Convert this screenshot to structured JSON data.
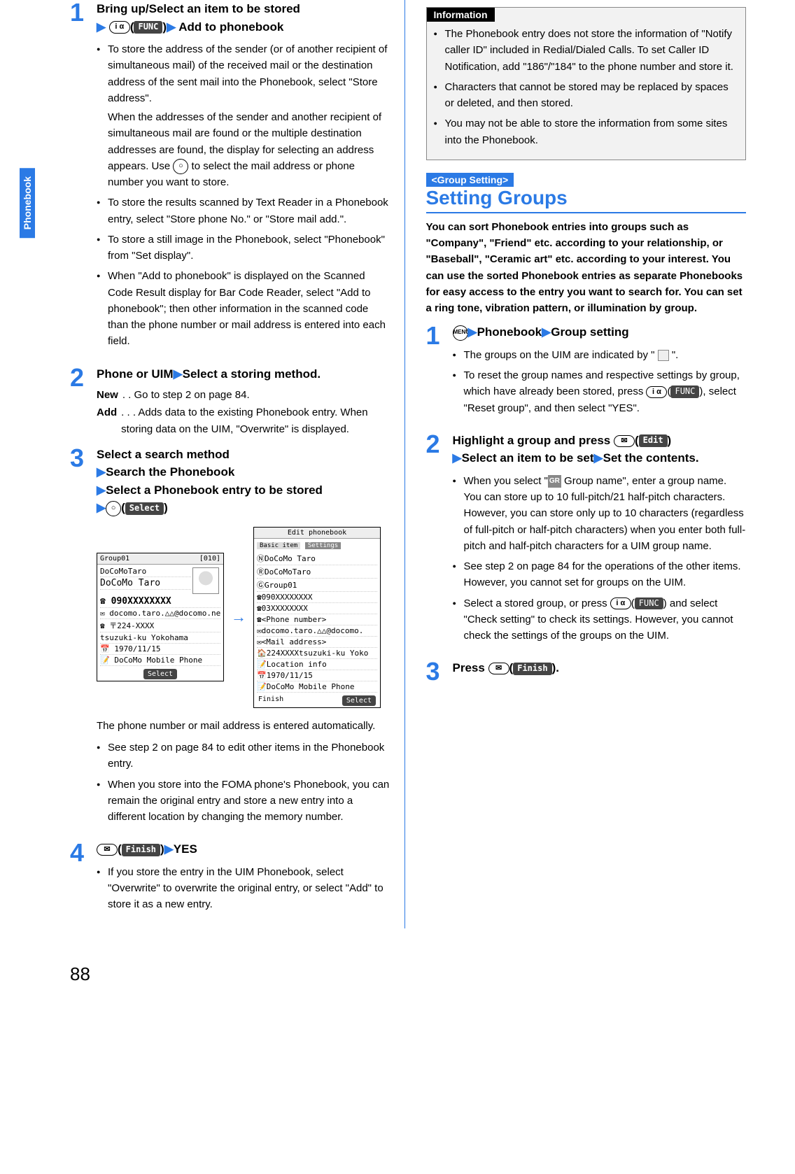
{
  "side_tab": "Phonebook",
  "page_number": "88",
  "left": {
    "step1": {
      "title_a": "Bring up/Select an item to be stored",
      "key1": "i α",
      "func": "FUNC",
      "title_b": "Add to phonebook",
      "b1": "To store the address of the sender (or of another recipient of simultaneous mail) of the received mail or the destination address of the sent mail into the Phonebook, select \"Store address\".",
      "b1_sub": "When the addresses of the sender and another recipient of simultaneous mail are found or the multiple destination addresses are found, the display for selecting an address appears. Use ",
      "b1_sub2": " to select the mail address or phone number you want to store.",
      "circle": "○",
      "b2": "To store the results scanned by Text Reader in a Phonebook entry, select \"Store phone No.\" or \"Store mail add.\".",
      "b3": "To store a still image in the Phonebook, select \"Phonebook\" from \"Set display\".",
      "b4": "When \"Add to phonebook\" is displayed on the Scanned Code Result display for Bar Code Reader, select \"Add to phonebook\"; then other information in the scanned code than the phone number or mail address is entered into each field."
    },
    "step2": {
      "title_a": "Phone or UIM",
      "title_b": "Select a storing method.",
      "new_label": "New",
      "new_text": ". . Go to step 2 on page 84.",
      "add_label": "Add",
      "add_text": ". . . Adds data to the existing Phonebook entry. When storing data on the UIM, \"Overwrite\" is displayed."
    },
    "step3": {
      "title_a": "Select a search method",
      "title_b": "Search the Phonebook",
      "title_c": "Select a Phonebook entry to be stored",
      "select_badge": "Select",
      "circle": "○",
      "fig_left": {
        "head_l": "Group01",
        "head_r": "[010]",
        "l1": "DoCoMoTaro",
        "l2": "DoCoMo Taro",
        "l3": "☎ 090XXXXXXXX",
        "l4": "✉ docomo.taro.△△@docomo.ne.jp",
        "l5": "☎ 〒224-XXXX",
        "l6": "  tsuzuki-ku Yokohama",
        "l7": "📅 1970/11/15",
        "l8": "📝 DoCoMo Mobile Phone",
        "footer": "Select"
      },
      "fig_right": {
        "head": "Edit phonebook",
        "tab1": "Basic item",
        "tab2": "Settings",
        "l1": "ⓃDoCoMo Taro",
        "l2": "ⓇDoCoMoTaro",
        "l3": "ⒼGroup01",
        "l4": "☎090XXXXXXXX",
        "l5": "☎03XXXXXXXX",
        "l6": "☎<Phone number>",
        "l7": "✉docomo.taro.△△@docomo.",
        "l8": "✉<Mail address>",
        "l9": "🏠224XXXXtsuzuki-ku Yoko",
        "l10": "📝Location info",
        "l11": "📅1970/11/15",
        "l12": "📝DoCoMo Mobile Phone",
        "footer_l": "Finish",
        "footer_r": "Select"
      },
      "after_fig_1": "The phone number or mail address is entered automatically.",
      "b1": "See step 2 on page 84 to edit other items in the Phonebook entry.",
      "b2": "When you store into the FOMA phone's Phonebook, you can remain the original entry and store a new entry into a different location by changing the memory number."
    },
    "step4": {
      "mail": "✉",
      "finish": "Finish",
      "yes": "YES",
      "b1": "If you store the entry in the UIM Phonebook, select \"Overwrite\" to overwrite the original entry, or select \"Add\" to store it as a new entry."
    }
  },
  "right": {
    "info_label": "Information",
    "info_b1": "The Phonebook entry does not store the information of \"Notify caller ID\" included in Redial/Dialed Calls. To set Caller ID Notification, add \"186\"/\"184\" to the phone number and store it.",
    "info_b2": "Characters that cannot be stored may be replaced by spaces or deleted, and then stored.",
    "info_b3": "You may not be able to store the information from some sites into the Phonebook.",
    "sect_tag": "<Group Setting>",
    "sect_title": "Setting Groups",
    "intro": "You can sort Phonebook entries into groups such as \"Company\", \"Friend\" etc. according to your relationship, or \"Baseball\", \"Ceramic art\" etc. according to your interest. You can use the sorted Phonebook entries as separate Phonebooks for easy access to the entry you want to search for. You can set a ring tone, vibration pattern, or illumination by group.",
    "step1": {
      "menu": "MENU",
      "title_a": "Phonebook",
      "title_b": "Group setting",
      "b1_a": "The groups on the UIM are indicated by \" ",
      "b1_b": " \".",
      "b2_a": "To reset the group names and respective settings by group, which have already been stored, press ",
      "key": "i α",
      "func": "FUNC",
      "b2_b": ", select \"Reset group\", and then select \"YES\"."
    },
    "step2": {
      "title_a": "Highlight a group and press ",
      "mail": "✉",
      "edit": "Edit",
      "title_b": "Select an item to be set",
      "title_c": "Set the contents.",
      "b1_a": "When you select \"",
      "gr": "GR",
      "b1_b": " Group name\", enter a group name. You can store up to 10 full-pitch/21 half-pitch characters. However, you can store only up to 10 characters (regardless of full-pitch or half-pitch characters) when you enter both full-pitch and half-pitch characters for a UIM group name.",
      "b2": "See step 2 on page 84 for the operations of the other items. However, you cannot set for groups on the UIM.",
      "b3_a": "Select a stored group, or press ",
      "key": "i α",
      "func": "FUNC",
      "b3_b": " and select \"Check setting\" to check its settings. However, you cannot check the settings of the groups on the UIM."
    },
    "step3": {
      "title_a": "Press ",
      "mail": "✉",
      "finish": "Finish",
      "title_b": "."
    }
  }
}
